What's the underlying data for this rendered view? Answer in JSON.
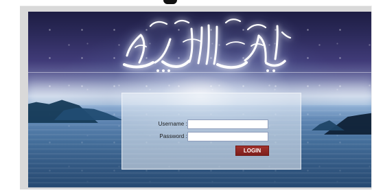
{
  "page": {
    "background_color": "#ffffff",
    "frame_color": "#d9d9d9"
  },
  "header_art": {
    "calligraphy_text": "بسم الله الرحمن الرحيم",
    "accent_color": "#ffffff"
  },
  "login": {
    "username_label": "Username :",
    "password_label": "Password :",
    "username_value": "",
    "password_value": "",
    "button_label": "LOGIN",
    "button_color": "#8b2320"
  }
}
